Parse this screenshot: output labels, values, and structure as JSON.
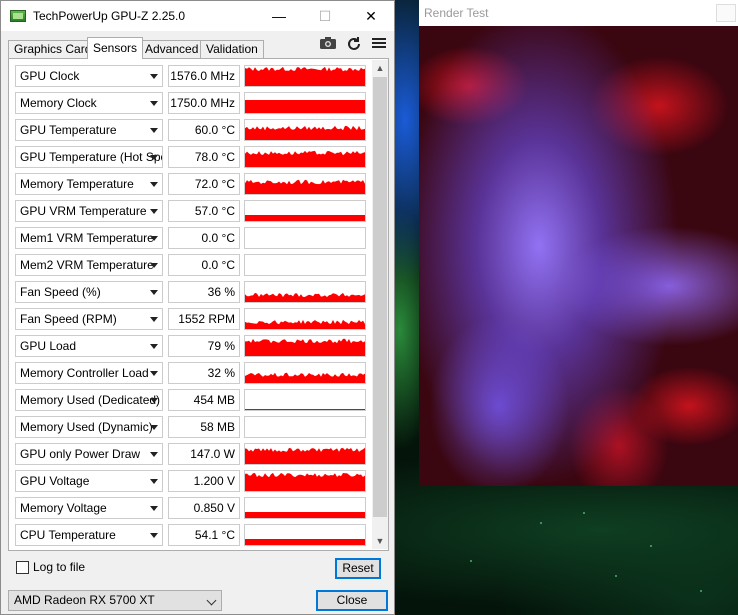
{
  "gpuz": {
    "title": "TechPowerUp GPU-Z 2.25.0",
    "controls": {
      "minimize": "—",
      "maximize": "☐",
      "close": "✕"
    },
    "tabs": [
      {
        "label": "Graphics Card",
        "active": false
      },
      {
        "label": "Sensors",
        "active": true
      },
      {
        "label": "Advanced",
        "active": false
      },
      {
        "label": "Validation",
        "active": false
      }
    ],
    "toolbar_icons": [
      "camera-icon",
      "refresh-icon",
      "menu-icon"
    ],
    "sensors": [
      {
        "name": "GPU Clock",
        "value": "1576.0 MHz",
        "level": 0.85,
        "graph": "noisy"
      },
      {
        "name": "Memory Clock",
        "value": "1750.0 MHz",
        "level": 0.65,
        "graph": "flat"
      },
      {
        "name": "GPU Temperature",
        "value": "60.0 °C",
        "level": 0.6,
        "graph": "noisy"
      },
      {
        "name": "GPU Temperature (Hot Spot)",
        "value": "78.0 °C",
        "level": 0.7,
        "graph": "noisy"
      },
      {
        "name": "Memory Temperature",
        "value": "72.0 °C",
        "level": 0.6,
        "graph": "noisy"
      },
      {
        "name": "GPU VRM Temperature",
        "value": "57.0 °C",
        "level": 0.3,
        "graph": "flat"
      },
      {
        "name": "Mem1 VRM Temperature",
        "value": "0.0 °C",
        "level": 0,
        "graph": "none"
      },
      {
        "name": "Mem2 VRM Temperature",
        "value": "0.0 °C",
        "level": 0,
        "graph": "none"
      },
      {
        "name": "Fan Speed (%)",
        "value": "36 %",
        "level": 0.35,
        "graph": "noisy"
      },
      {
        "name": "Fan Speed (RPM)",
        "value": "1552 RPM",
        "level": 0.35,
        "graph": "noisy"
      },
      {
        "name": "GPU Load",
        "value": "79 %",
        "level": 0.75,
        "graph": "noisy"
      },
      {
        "name": "Memory Controller Load",
        "value": "32 %",
        "level": 0.4,
        "graph": "noisy"
      },
      {
        "name": "Memory Used (Dedicated)",
        "value": "454 MB",
        "level": 0.05,
        "graph": "flat"
      },
      {
        "name": "Memory Used (Dynamic)",
        "value": "58 MB",
        "level": 0,
        "graph": "none"
      },
      {
        "name": "GPU only Power Draw",
        "value": "147.0 W",
        "level": 0.7,
        "graph": "noisy"
      },
      {
        "name": "GPU Voltage",
        "value": "1.200 V",
        "level": 0.8,
        "graph": "noisy"
      },
      {
        "name": "Memory Voltage",
        "value": "0.850 V",
        "level": 0.3,
        "graph": "flat"
      },
      {
        "name": "CPU Temperature",
        "value": "54.1 °C",
        "level": 0.3,
        "graph": "flat"
      }
    ],
    "log_to_file_label": "Log to file",
    "log_to_file_checked": false,
    "reset_label": "Reset",
    "gpu_select_value": "AMD Radeon RX 5700 XT",
    "close_label": "Close",
    "graph_color": "#ff0000"
  },
  "render_test": {
    "title": "Render Test"
  }
}
